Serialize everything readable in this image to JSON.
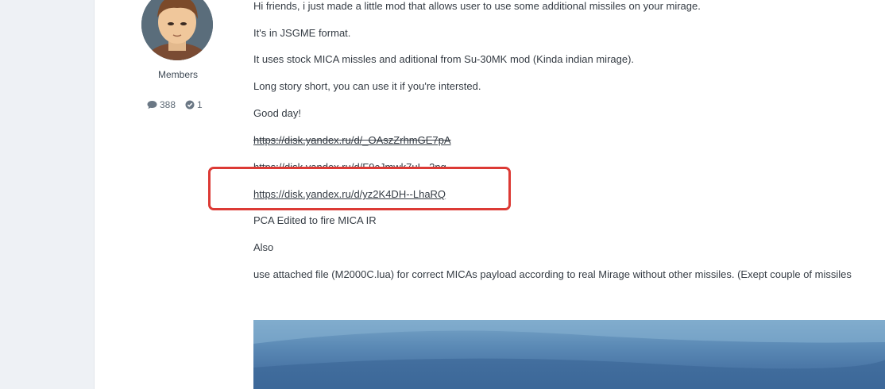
{
  "author": {
    "group": "Members",
    "posts_count": "388",
    "reputation": "1"
  },
  "post": {
    "paragraphs": {
      "p1": "Hi friends, i just made a little mod that allows user to use some additional missiles on your mirage.",
      "p2": "It's in JSGME format.",
      "p3": "It uses stock MICA missles and aditional from Su-30MK mod (Kinda indian mirage).",
      "p4": "Long story short, you can use it if you're intersted.",
      "p5": "Good day!",
      "p6": "PCA Edited to fire MICA IR",
      "p7": "Also",
      "p8": "use attached file (M2000C.lua) for correct MICAs payload according to real Mirage without other missiles. (Exept couple of missiles"
    },
    "links": {
      "link1": "https://disk.yandex.ru/d/_OAszZrhmGE7pA",
      "link2": "https://disk.yandex.ru/d/F9cJmwk7uL_2ng",
      "link3": "https://disk.yandex.ru/d/yz2K4DH--LhaRQ"
    }
  },
  "icons": {
    "posts": "speech-bubble-icon",
    "reputation": "check-circle-icon"
  },
  "colors": {
    "annotation_box": "#dc3a35",
    "text": "#353c44",
    "page_bg": "#eef1f5"
  }
}
